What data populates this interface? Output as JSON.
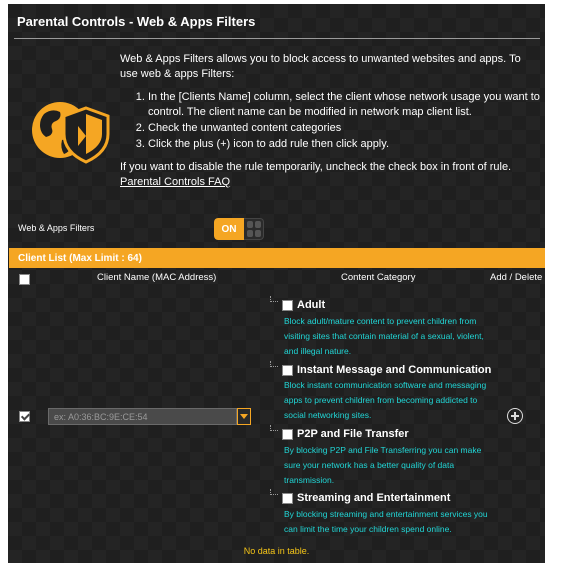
{
  "page": {
    "title": "Parental Controls - Web & Apps Filters"
  },
  "description": {
    "intro": "Web & Apps Filters allows you to block access to unwanted websites and apps. To use web & apps Filters:",
    "steps": [
      "In the [Clients Name] column, select the client whose network usage you want to control. The client name can be modified in network map client list.",
      "Check the unwanted content categories",
      "Click the plus (+) icon to add rule then click apply."
    ],
    "note": "If you want to disable the rule temporarily, uncheck the check box in front of rule.",
    "faq_link": "Parental Controls FAQ"
  },
  "filter_toggle": {
    "label": "Web & Apps Filters",
    "state": "ON"
  },
  "client_list": {
    "header": "Client List (Max Limit : 64)",
    "columns": {
      "client": "Client Name (MAC Address)",
      "category": "Content Category",
      "action": "Add / Delete"
    },
    "mac_placeholder": "ex: A0:36:BC:9E:CE:54",
    "empty_text": "No data in table."
  },
  "categories": [
    {
      "title": "Adult",
      "desc": "Block adult/mature content to prevent children from visiting sites that contain material of a sexual, violent, and illegal nature."
    },
    {
      "title": "Instant Message and Communication",
      "desc": "Block instant communication software and messaging apps to prevent children from becoming addicted to social networking sites."
    },
    {
      "title": "P2P and File Transfer",
      "desc": "By blocking P2P and File Transferring you can make sure your network has a better quality of data transmission."
    },
    {
      "title": "Streaming and Entertainment",
      "desc": "By blocking streaming and entertainment services you can limit the time your children spend online."
    }
  ],
  "colors": {
    "accent": "#f5a623",
    "desc_text": "#21d6d6",
    "empty_text": "#f5c518",
    "background": "#1f1f1f"
  },
  "icons": [
    "globe-shield-logo",
    "add-icon",
    "chevron-down-icon"
  ]
}
